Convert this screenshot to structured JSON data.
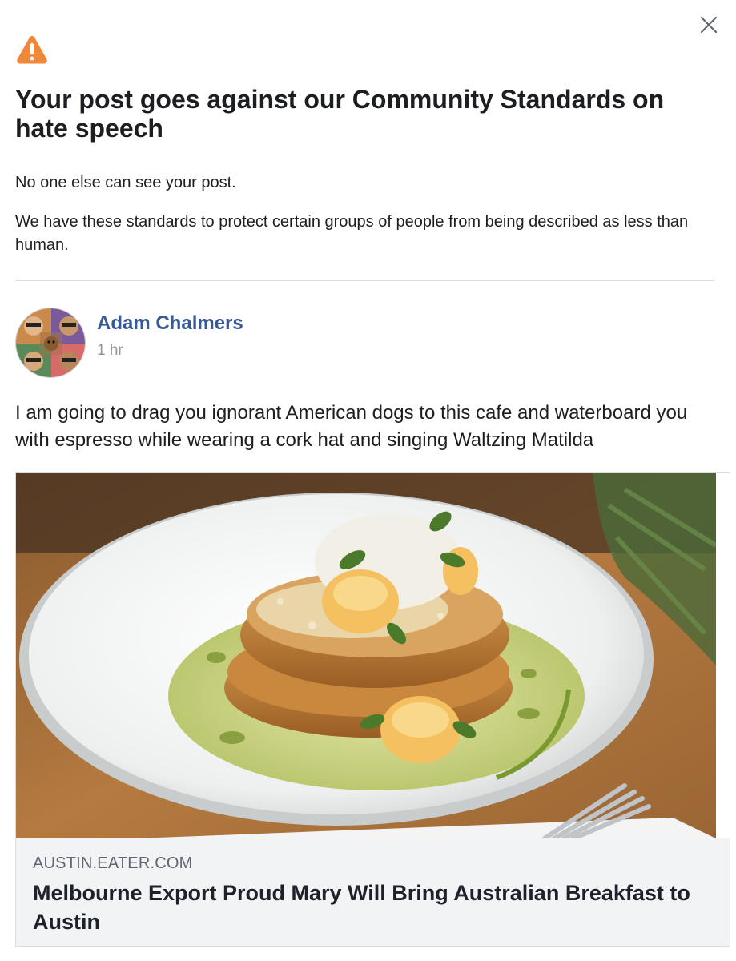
{
  "dialog": {
    "close_icon": "close-icon",
    "warning_icon": "warning-triangle-icon",
    "warning_color": "#f0883a",
    "title": "Your post goes against our Community Standards on hate speech",
    "notice": "No one else can see your post.",
    "explanation": "We have these standards to protect certain groups of people from being described as less than human."
  },
  "post": {
    "author": {
      "name": "Adam Chalmers",
      "avatar_icon": "avatar"
    },
    "timestamp": "1 hr",
    "text": "I am going to drag you ignorant American dogs to this cafe and waterboard you with espresso while wearing a cork hat and singing Waltzing Matilda",
    "link_preview": {
      "domain": "AUSTIN.EATER.COM",
      "title": "Melbourne Export Proud Mary Will Bring Australian Breakfast to Austin"
    }
  },
  "colors": {
    "author_link": "#385898",
    "meta_text": "#90949c",
    "card_background": "#f2f3f5",
    "divider": "#dadde1"
  }
}
